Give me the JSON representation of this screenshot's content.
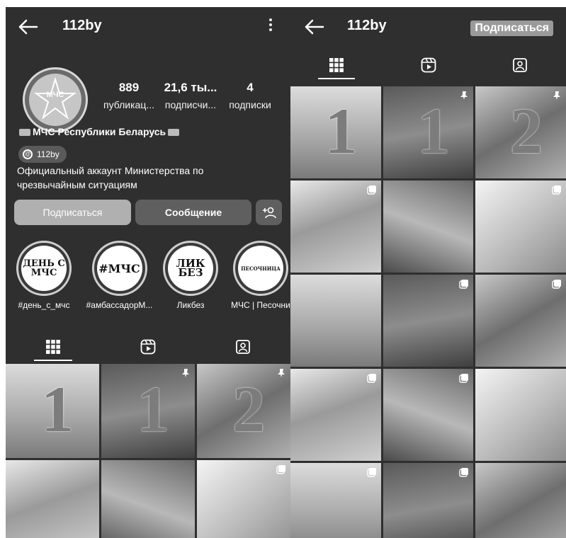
{
  "left": {
    "header": {
      "title": "112by"
    },
    "profile": {
      "avatar_text": "МЧС",
      "stats": [
        {
          "value": "889",
          "label": "публикац..."
        },
        {
          "value": "21,6 ты...",
          "label": "подписчи..."
        },
        {
          "value": "4",
          "label": "подписки"
        }
      ],
      "name": "МЧС Республики Беларусь",
      "threads_handle": "112by",
      "bio": "Официальный аккаунт Министерства по чрезвычайным ситуациям"
    },
    "buttons": {
      "subscribe": "Подписаться",
      "message": "Сообщение"
    },
    "highlights": [
      {
        "cover": "ДЕНЬ С МЧС",
        "label": "#день_с_мчс"
      },
      {
        "cover": "#МЧС",
        "label": "#амбассадорМ..."
      },
      {
        "cover": "ЛИК БЕЗ",
        "label": "Ликбез"
      },
      {
        "cover": "ПЕСОЧНИЦА",
        "label": "МЧС | Песочни"
      }
    ],
    "tabs": [
      {
        "icon": "grid-icon"
      },
      {
        "icon": "reels-icon"
      },
      {
        "icon": "tagged-icon"
      }
    ],
    "posts": [
      {
        "overlay": "1",
        "badge": ""
      },
      {
        "overlay": "1",
        "badge": "pin-icon"
      },
      {
        "overlay": "2",
        "badge": "pin-icon"
      },
      {
        "overlay": "",
        "badge": ""
      },
      {
        "overlay": "",
        "badge": ""
      },
      {
        "overlay": "",
        "badge": "carousel-icon"
      }
    ]
  },
  "right": {
    "header": {
      "title": "112by",
      "subscribe": "Подписаться"
    },
    "tabs": [
      {
        "icon": "grid-icon"
      },
      {
        "icon": "reels-icon"
      },
      {
        "icon": "tagged-icon"
      }
    ],
    "posts": [
      {
        "overlay": "1",
        "badge": ""
      },
      {
        "overlay": "1",
        "badge": "pin-icon"
      },
      {
        "overlay": "2",
        "badge": "pin-icon"
      },
      {
        "overlay": "",
        "badge": "carousel-icon"
      },
      {
        "overlay": "",
        "badge": ""
      },
      {
        "overlay": "",
        "badge": "carousel-icon"
      },
      {
        "overlay": "",
        "badge": ""
      },
      {
        "overlay": "",
        "badge": "carousel-icon"
      },
      {
        "overlay": "",
        "badge": "carousel-icon"
      },
      {
        "overlay": "",
        "badge": "carousel-icon"
      },
      {
        "overlay": "",
        "badge": "carousel-icon"
      },
      {
        "overlay": "",
        "badge": ""
      },
      {
        "overlay": "",
        "badge": "carousel-icon"
      },
      {
        "overlay": "",
        "badge": "carousel-icon"
      },
      {
        "overlay": "",
        "badge": ""
      }
    ]
  },
  "colors": {
    "background": "#2f2f2f",
    "text": "#ffffff",
    "button_primary": "#b0b0b0",
    "button_secondary": "#5f5f5f"
  }
}
